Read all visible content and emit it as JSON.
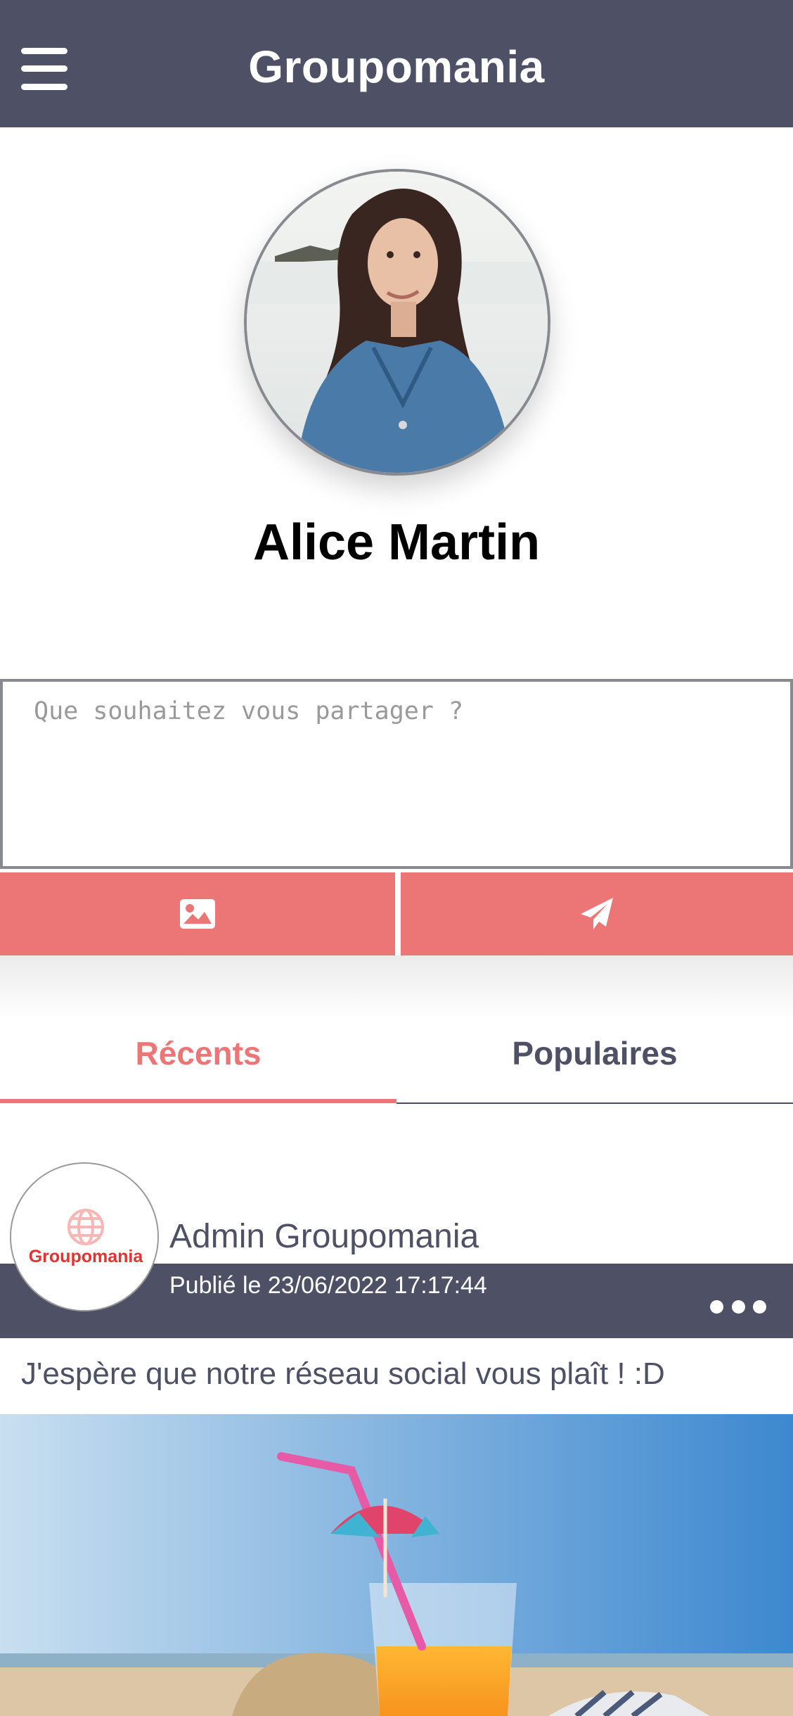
{
  "header": {
    "title": "Groupomania"
  },
  "profile": {
    "name": "Alice Martin"
  },
  "composer": {
    "placeholder": "Que souhaitez vous partager ?"
  },
  "actions": {
    "image_icon": "image-icon",
    "send_icon": "paper-plane-icon"
  },
  "tabs": [
    {
      "label": "Récents",
      "active": true
    },
    {
      "label": "Populaires",
      "active": false
    }
  ],
  "post": {
    "logo_text": "Groupomania",
    "author": "Admin Groupomania",
    "date": "Publié le 23/06/2022 17:17:44",
    "text": "J'espère que notre réseau social vous plaît ! :D"
  },
  "colors": {
    "header_bg": "#4e5166",
    "accent": "#ec7675",
    "text_dark": "#4e5166"
  }
}
